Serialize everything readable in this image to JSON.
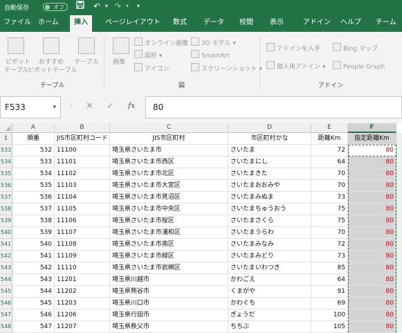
{
  "titlebar": {
    "autosave_label": "自動保存",
    "autosave_toggle": "オフ",
    "save_icon": "save-icon",
    "undo_icon": "undo-icon",
    "redo_icon": "redo-icon",
    "customize_icon": "customize-qat-icon"
  },
  "tabs": [
    "ファイル",
    "ホーム",
    "挿入",
    "ページレイアウト",
    "数式",
    "データ",
    "校閲",
    "表示",
    "アドイン",
    "ヘルプ",
    "チーム"
  ],
  "active_tab": "挿入",
  "ribbon": {
    "tables": {
      "pivot_label_1": "ピボット",
      "pivot_label_2": "テーブル",
      "recommended_label_1": "おすすめ",
      "recommended_label_2": "ピボットテーブル",
      "table_label": "テーブル",
      "group_label": "テーブル"
    },
    "illustrations": {
      "picture_label": "画像",
      "online_picture_label": "オンライン画像",
      "shapes_label": "図形",
      "icons_label": "アイコン",
      "model3d_label": "3D モデル",
      "smartart_label": "SmartArt",
      "screenshot_label": "スクリーンショット",
      "group_label": "図"
    },
    "addins": {
      "get_addins_label": "アドインを入手",
      "my_addins_label": "個人用アドイン",
      "bing_maps_label": "Bing マップ",
      "people_graph_label": "People Graph",
      "group_label": "アドイン"
    }
  },
  "formula_bar": {
    "name_box": "F533",
    "cancel_icon": "✕",
    "enter_icon": "✓",
    "fx_label": "fx",
    "value": "80"
  },
  "columns": [
    "A",
    "B",
    "C",
    "D",
    "E",
    "F"
  ],
  "header_row": {
    "row_number": "1",
    "cells": [
      "順番",
      "JIS市区町村コード",
      "JIS市区町村",
      "市区町村かな",
      "距離Km",
      "指定距離Km"
    ]
  },
  "rows": [
    {
      "row": "533",
      "a": "532",
      "b": "11100",
      "c": "埼玉県さいたま市",
      "d": "さいたま",
      "e": "72",
      "f": "80"
    },
    {
      "row": "534",
      "a": "533",
      "b": "11101",
      "c": "埼玉県さいたま市西区",
      "d": "さいたまにし",
      "e": "64",
      "f": "80"
    },
    {
      "row": "535",
      "a": "534",
      "b": "11102",
      "c": "埼玉県さいたま市北区",
      "d": "さいたまきた",
      "e": "70",
      "f": "80"
    },
    {
      "row": "536",
      "a": "535",
      "b": "11103",
      "c": "埼玉県さいたま市大宮区",
      "d": "さいたまおおみや",
      "e": "70",
      "f": "80"
    },
    {
      "row": "537",
      "a": "536",
      "b": "11104",
      "c": "埼玉県さいたま市見沼区",
      "d": "さいたまみぬま",
      "e": "73",
      "f": "80"
    },
    {
      "row": "538",
      "a": "537",
      "b": "11105",
      "c": "埼玉県さいたま市中央区",
      "d": "さいたまちゅうおう",
      "e": "75",
      "f": "80"
    },
    {
      "row": "539",
      "a": "538",
      "b": "11106",
      "c": "埼玉県さいたま市桜区",
      "d": "さいたまさくら",
      "e": "75",
      "f": "80"
    },
    {
      "row": "540",
      "a": "539",
      "b": "11107",
      "c": "埼玉県さいたま市浦和区",
      "d": "さいたまうらわ",
      "e": "70",
      "f": "80"
    },
    {
      "row": "541",
      "a": "540",
      "b": "11108",
      "c": "埼玉県さいたま市南区",
      "d": "さいたまみなみ",
      "e": "72",
      "f": "80"
    },
    {
      "row": "542",
      "a": "541",
      "b": "11109",
      "c": "埼玉県さいたま市緑区",
      "d": "さいたまみどり",
      "e": "73",
      "f": "80"
    },
    {
      "row": "543",
      "a": "542",
      "b": "11110",
      "c": "埼玉県さいたま市岩槻区",
      "d": "さいたまいわつき",
      "e": "85",
      "f": "80"
    },
    {
      "row": "544",
      "a": "543",
      "b": "11201",
      "c": "埼玉県川越市",
      "d": "かわごえ",
      "e": "64",
      "f": "80"
    },
    {
      "row": "545",
      "a": "544",
      "b": "11202",
      "c": "埼玉県熊谷市",
      "d": "くまがや",
      "e": "91",
      "f": "80"
    },
    {
      "row": "546",
      "a": "545",
      "b": "11203",
      "c": "埼玉県川口市",
      "d": "かわぐち",
      "e": "69",
      "f": "80"
    },
    {
      "row": "547",
      "a": "546",
      "b": "11206",
      "c": "埼玉県行田市",
      "d": "ぎょうだ",
      "e": "100",
      "f": "80"
    },
    {
      "row": "548",
      "a": "547",
      "b": "11207",
      "c": "埼玉県秩父市",
      "d": "ちちぶ",
      "e": "105",
      "f": "80"
    }
  ],
  "colors": {
    "accent": "#217346",
    "value_red": "#e00000",
    "selected_col_bg": "#d4d4d4"
  }
}
